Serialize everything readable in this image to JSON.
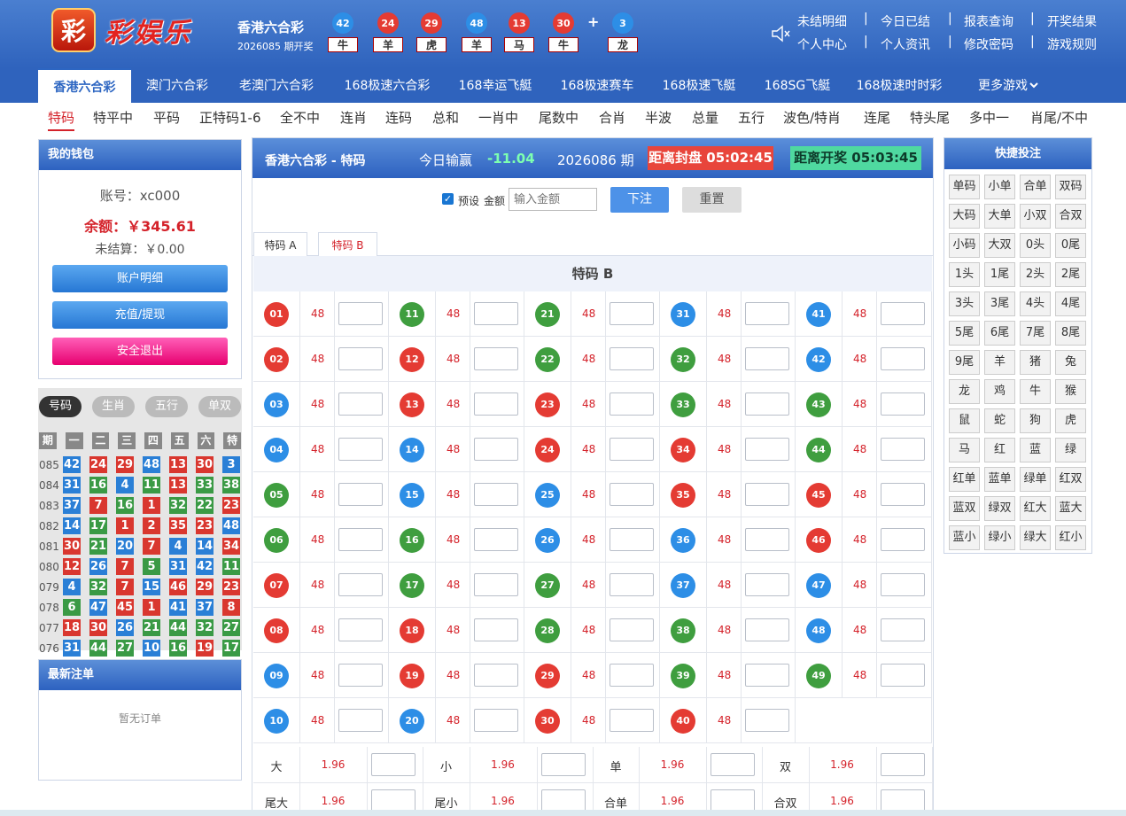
{
  "logo": {
    "glyph": "彩",
    "text": "彩娱乐"
  },
  "lottery": {
    "name": "香港六合彩",
    "issue": "2026085 期开奖"
  },
  "draw": [
    {
      "num": "42",
      "zodiac": "牛",
      "color": "#2d8ee6"
    },
    {
      "num": "24",
      "zodiac": "羊",
      "color": "#e43b33"
    },
    {
      "num": "29",
      "zodiac": "虎",
      "color": "#e43b33"
    },
    {
      "num": "48",
      "zodiac": "羊",
      "color": "#2d8ee6"
    },
    {
      "num": "13",
      "zodiac": "马",
      "color": "#e43b33"
    },
    {
      "num": "30",
      "zodiac": "牛",
      "color": "#e43b33"
    },
    {
      "num": "3",
      "zodiac": "龙",
      "color": "#2d8ee6"
    }
  ],
  "plus": "+",
  "top_links_row1": [
    "未结明细",
    "今日已结",
    "报表查询",
    "开奖结果"
  ],
  "top_links_row2": [
    "个人中心",
    "个人资讯",
    "修改密码",
    "游戏规则"
  ],
  "nav": [
    "香港六合彩",
    "澳门六合彩",
    "老澳门六合彩",
    "168极速六合彩",
    "168幸运飞艇",
    "168极速赛车",
    "168极速飞艇",
    "168SG飞艇",
    "168极速时时彩",
    "更多游戏"
  ],
  "subnav": [
    "特码",
    "特平中",
    "平码",
    "正特码1-6",
    "全不中",
    "连肖",
    "连码",
    "总和",
    "一肖中",
    "尾数中",
    "合肖",
    "半波",
    "总量",
    "五行",
    "波色/特肖",
    "连尾",
    "特头尾",
    "多中一",
    "肖尾/不中"
  ],
  "wallet": {
    "title": "我的钱包",
    "account": "账号：xc000",
    "balance": "余额：￥345.61",
    "pending": "未结算：￥0.00",
    "btn_detail": "账户明细",
    "btn_recharge": "充值/提现",
    "btn_logout": "安全退出"
  },
  "history_tabs": [
    "号码",
    "生肖",
    "五行",
    "单双"
  ],
  "history_head": [
    "期",
    "一",
    "二",
    "三",
    "四",
    "五",
    "六",
    "特"
  ],
  "history": [
    {
      "p": "085",
      "n": [
        [
          "42",
          "b"
        ],
        [
          "24",
          "r"
        ],
        [
          "29",
          "r"
        ],
        [
          "48",
          "b"
        ],
        [
          "13",
          "r"
        ],
        [
          "30",
          "r"
        ],
        [
          "3",
          "b"
        ]
      ]
    },
    {
      "p": "084",
      "n": [
        [
          "31",
          "b"
        ],
        [
          "16",
          "g"
        ],
        [
          "4",
          "b"
        ],
        [
          "11",
          "g"
        ],
        [
          "13",
          "r"
        ],
        [
          "33",
          "g"
        ],
        [
          "38",
          "g"
        ]
      ]
    },
    {
      "p": "083",
      "n": [
        [
          "37",
          "b"
        ],
        [
          "7",
          "r"
        ],
        [
          "16",
          "g"
        ],
        [
          "1",
          "r"
        ],
        [
          "32",
          "g"
        ],
        [
          "22",
          "g"
        ],
        [
          "23",
          "r"
        ]
      ]
    },
    {
      "p": "082",
      "n": [
        [
          "14",
          "b"
        ],
        [
          "17",
          "g"
        ],
        [
          "1",
          "r"
        ],
        [
          "2",
          "r"
        ],
        [
          "35",
          "r"
        ],
        [
          "23",
          "r"
        ],
        [
          "48",
          "b"
        ]
      ]
    },
    {
      "p": "081",
      "n": [
        [
          "30",
          "r"
        ],
        [
          "21",
          "g"
        ],
        [
          "20",
          "b"
        ],
        [
          "7",
          "r"
        ],
        [
          "4",
          "b"
        ],
        [
          "14",
          "b"
        ],
        [
          "34",
          "r"
        ]
      ]
    },
    {
      "p": "080",
      "n": [
        [
          "12",
          "r"
        ],
        [
          "26",
          "b"
        ],
        [
          "7",
          "r"
        ],
        [
          "5",
          "g"
        ],
        [
          "31",
          "b"
        ],
        [
          "42",
          "b"
        ],
        [
          "11",
          "g"
        ]
      ]
    },
    {
      "p": "079",
      "n": [
        [
          "4",
          "b"
        ],
        [
          "32",
          "g"
        ],
        [
          "7",
          "r"
        ],
        [
          "15",
          "b"
        ],
        [
          "46",
          "r"
        ],
        [
          "29",
          "r"
        ],
        [
          "23",
          "r"
        ]
      ]
    },
    {
      "p": "078",
      "n": [
        [
          "6",
          "g"
        ],
        [
          "47",
          "b"
        ],
        [
          "45",
          "r"
        ],
        [
          "1",
          "r"
        ],
        [
          "41",
          "b"
        ],
        [
          "37",
          "b"
        ],
        [
          "8",
          "r"
        ]
      ]
    },
    {
      "p": "077",
      "n": [
        [
          "18",
          "r"
        ],
        [
          "30",
          "r"
        ],
        [
          "26",
          "b"
        ],
        [
          "21",
          "g"
        ],
        [
          "44",
          "g"
        ],
        [
          "32",
          "g"
        ],
        [
          "27",
          "g"
        ]
      ]
    },
    {
      "p": "076",
      "n": [
        [
          "31",
          "b"
        ],
        [
          "44",
          "g"
        ],
        [
          "27",
          "g"
        ],
        [
          "10",
          "b"
        ],
        [
          "16",
          "g"
        ],
        [
          "19",
          "r"
        ],
        [
          "17",
          "g"
        ]
      ]
    }
  ],
  "latest": {
    "title": "最新注单",
    "empty": "暂无订单"
  },
  "main": {
    "title": "香港六合彩 - 特码",
    "today_label": "今日输赢",
    "today_val": "-11.04",
    "issue": "2026086 期",
    "close_label": "距离封盘 05:02:45",
    "open_label": "距离开奖 05:03:45"
  },
  "toolbar": {
    "preset": "预设",
    "amount_label": "金额",
    "placeholder": "输入金额",
    "bet": "下注",
    "reset": "重置"
  },
  "tabs": [
    "特码 A",
    "特码 B"
  ],
  "grid_title": "特码 B",
  "odds": "48",
  "numbers": [
    {
      "n": "01",
      "c": "r"
    },
    {
      "n": "02",
      "c": "r"
    },
    {
      "n": "03",
      "c": "b"
    },
    {
      "n": "04",
      "c": "b"
    },
    {
      "n": "05",
      "c": "g"
    },
    {
      "n": "06",
      "c": "g"
    },
    {
      "n": "07",
      "c": "r"
    },
    {
      "n": "08",
      "c": "r"
    },
    {
      "n": "09",
      "c": "b"
    },
    {
      "n": "10",
      "c": "b"
    },
    {
      "n": "11",
      "c": "g"
    },
    {
      "n": "12",
      "c": "r"
    },
    {
      "n": "13",
      "c": "r"
    },
    {
      "n": "14",
      "c": "b"
    },
    {
      "n": "15",
      "c": "b"
    },
    {
      "n": "16",
      "c": "g"
    },
    {
      "n": "17",
      "c": "g"
    },
    {
      "n": "18",
      "c": "r"
    },
    {
      "n": "19",
      "c": "r"
    },
    {
      "n": "20",
      "c": "b"
    },
    {
      "n": "21",
      "c": "g"
    },
    {
      "n": "22",
      "c": "g"
    },
    {
      "n": "23",
      "c": "r"
    },
    {
      "n": "24",
      "c": "r"
    },
    {
      "n": "25",
      "c": "b"
    },
    {
      "n": "26",
      "c": "b"
    },
    {
      "n": "27",
      "c": "g"
    },
    {
      "n": "28",
      "c": "g"
    },
    {
      "n": "29",
      "c": "r"
    },
    {
      "n": "30",
      "c": "r"
    },
    {
      "n": "31",
      "c": "b"
    },
    {
      "n": "32",
      "c": "g"
    },
    {
      "n": "33",
      "c": "g"
    },
    {
      "n": "34",
      "c": "r"
    },
    {
      "n": "35",
      "c": "r"
    },
    {
      "n": "36",
      "c": "b"
    },
    {
      "n": "37",
      "c": "b"
    },
    {
      "n": "38",
      "c": "g"
    },
    {
      "n": "39",
      "c": "g"
    },
    {
      "n": "40",
      "c": "r"
    },
    {
      "n": "41",
      "c": "b"
    },
    {
      "n": "42",
      "c": "b"
    },
    {
      "n": "43",
      "c": "g"
    },
    {
      "n": "44",
      "c": "g"
    },
    {
      "n": "45",
      "c": "r"
    },
    {
      "n": "46",
      "c": "r"
    },
    {
      "n": "47",
      "c": "b"
    },
    {
      "n": "48",
      "c": "b"
    },
    {
      "n": "49",
      "c": "g"
    }
  ],
  "bottom": [
    [
      {
        "l": "大",
        "o": "1.96"
      },
      {
        "l": "小",
        "o": "1.96"
      },
      {
        "l": "单",
        "o": "1.96"
      },
      {
        "l": "双",
        "o": "1.96"
      }
    ],
    [
      {
        "l": "尾大",
        "o": "1.96"
      },
      {
        "l": "尾小",
        "o": "1.96"
      },
      {
        "l": "合单",
        "o": "1.96"
      },
      {
        "l": "合双",
        "o": "1.96"
      }
    ]
  ],
  "quick": {
    "title": "快捷投注",
    "items": [
      "单码",
      "小单",
      "合单",
      "双码",
      "大码",
      "大单",
      "小双",
      "合双",
      "小码",
      "大双",
      "0头",
      "0尾",
      "1头",
      "1尾",
      "2头",
      "2尾",
      "3头",
      "3尾",
      "4头",
      "4尾",
      "5尾",
      "6尾",
      "7尾",
      "8尾",
      "9尾",
      "羊",
      "猪",
      "兔",
      "龙",
      "鸡",
      "牛",
      "猴",
      "鼠",
      "蛇",
      "狗",
      "虎",
      "马",
      "红",
      "蓝",
      "绿",
      "红单",
      "蓝单",
      "绿单",
      "红双",
      "蓝双",
      "绿双",
      "红大",
      "蓝大",
      "蓝小",
      "绿小",
      "绿大",
      "红小"
    ]
  },
  "colors": {
    "r": "#e43b33",
    "b": "#2d8ee6",
    "g": "#3f9e3f",
    "hr": "#d9372f",
    "hb": "#2a7fd6",
    "hg": "#3a9a45"
  }
}
